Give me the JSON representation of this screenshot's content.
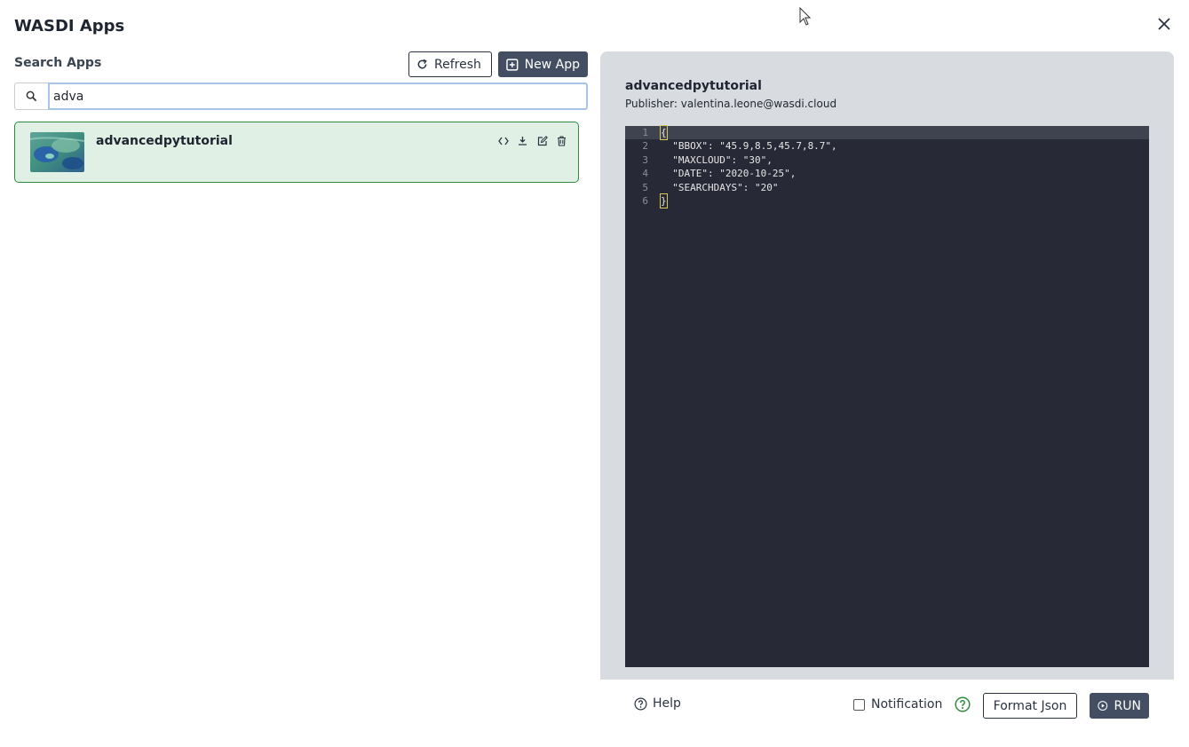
{
  "dialog": {
    "title": "WASDI Apps",
    "close_icon": "close-icon"
  },
  "search": {
    "label": "Search Apps",
    "refresh_label": "Refresh",
    "new_app_label": "New App",
    "value": "adva",
    "icon": "search-icon"
  },
  "apps": [
    {
      "name": "advancedpytutorial",
      "actions": [
        "code-icon",
        "download-icon",
        "edit-icon",
        "trash-icon"
      ]
    }
  ],
  "detail": {
    "name": "advancedpytutorial",
    "publisher": "Publisher: valentina.leone@wasdi.cloud"
  },
  "editor": {
    "lines": [
      {
        "no": "1",
        "code": "{"
      },
      {
        "no": "2",
        "code": "  \"BBOX\": \"45.9,8.5,45.7,8.7\","
      },
      {
        "no": "3",
        "code": "  \"MAXCLOUD\": \"30\","
      },
      {
        "no": "4",
        "code": "  \"DATE\": \"2020-10-25\","
      },
      {
        "no": "5",
        "code": "  \"SEARCHDAYS\": \"20\""
      },
      {
        "no": "6",
        "code": "}"
      }
    ]
  },
  "footer": {
    "help_label": "Help",
    "notification_label": "Notification",
    "format_json_label": "Format Json",
    "run_label": "RUN"
  },
  "colors": {
    "accent_dark": "#434e63",
    "card_bg": "#e1f0e4",
    "card_border": "#2e8b3e",
    "panel_bg": "#d8dbe0",
    "editor_bg": "#272a36",
    "help_green": "#2e8b3e"
  }
}
